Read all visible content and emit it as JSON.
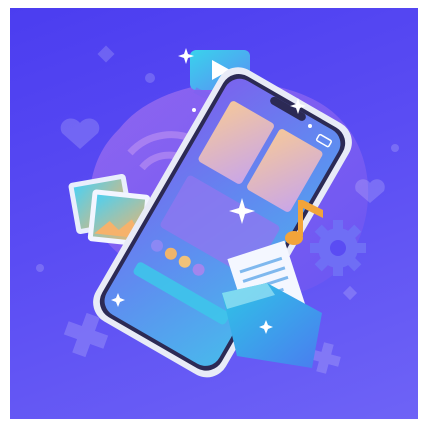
{
  "scene": {
    "description_name": "smartphone-media-illustration",
    "colors": {
      "background": "#5347f2",
      "phone_body": "#e8ebf7",
      "screen": "#6a8cf0",
      "accent_cyan": "#36c9e8",
      "accent_orange": "#f0b46a",
      "music_note": "#f2a43a",
      "gear": "#6f6ef5"
    }
  }
}
